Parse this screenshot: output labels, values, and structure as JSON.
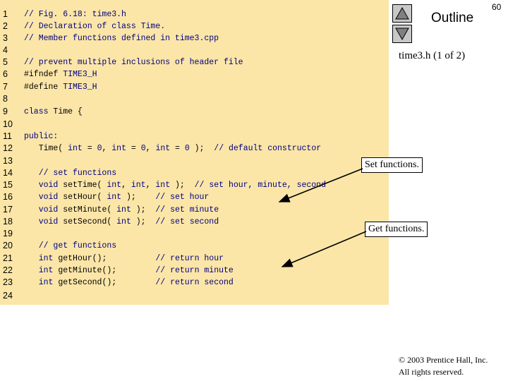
{
  "header": {
    "outline_label": "Outline",
    "page_number": "60",
    "file_caption": "time3.h (1 of 2)",
    "nav_up_icon": "triangle-up-icon",
    "nav_down_icon": "triangle-down-icon"
  },
  "code_lines": [
    {
      "n": "1",
      "t": "// Fig. 6.18: time3.h"
    },
    {
      "n": "2",
      "t": "// Declaration of class Time."
    },
    {
      "n": "3",
      "t": "// Member functions defined in time3.cpp"
    },
    {
      "n": "4",
      "t": ""
    },
    {
      "n": "5",
      "t": "// prevent multiple inclusions of header file"
    },
    {
      "n": "6",
      "t": "#ifndef TIME3_H"
    },
    {
      "n": "7",
      "t": "#define TIME3_H"
    },
    {
      "n": "8",
      "t": ""
    },
    {
      "n": "9",
      "t": "class Time {"
    },
    {
      "n": "10",
      "t": ""
    },
    {
      "n": "11",
      "t": "public:"
    },
    {
      "n": "12",
      "t": "   Time( int = 0, int = 0, int = 0 );  // default constructor"
    },
    {
      "n": "13",
      "t": ""
    },
    {
      "n": "14",
      "t": "   // set functions"
    },
    {
      "n": "15",
      "t": "   void setTime( int, int, int );  // set hour, minute, second"
    },
    {
      "n": "16",
      "t": "   void setHour( int );    // set hour"
    },
    {
      "n": "17",
      "t": "   void setMinute( int );  // set minute"
    },
    {
      "n": "18",
      "t": "   void setSecond( int );  // set second"
    },
    {
      "n": "19",
      "t": ""
    },
    {
      "n": "20",
      "t": "   // get functions"
    },
    {
      "n": "21",
      "t": "   int getHour();          // return hour"
    },
    {
      "n": "22",
      "t": "   int getMinute();        // return minute"
    },
    {
      "n": "23",
      "t": "   int getSecond();        // return second"
    },
    {
      "n": "24",
      "t": ""
    }
  ],
  "callouts": {
    "set_label": "Set functions.",
    "get_label": "Get functions."
  },
  "footer": {
    "copyright_line1": "© 2003 Prentice Hall, Inc.",
    "copyright_line2": "All rights reserved."
  },
  "colors": {
    "code_background": "#fbe6a8",
    "nav_button": "#c8c8c8",
    "keyword_blue": "#000080"
  }
}
